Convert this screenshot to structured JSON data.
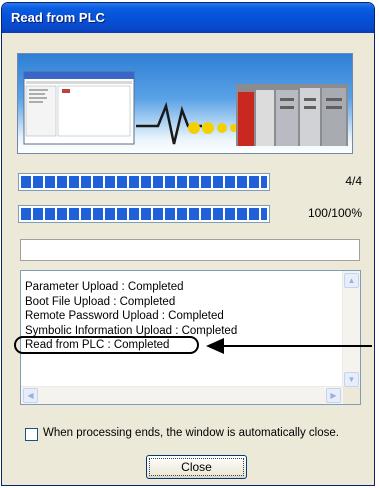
{
  "window": {
    "title": "Read from PLC"
  },
  "progress": {
    "step_count": "4/4",
    "step_fraction": 1.0,
    "percent_label": "100/100%",
    "percent_fraction": 1.0
  },
  "log": {
    "lines": [
      "Parameter Upload : Completed",
      "Boot File Upload : Completed",
      "Remote Password Upload : Completed",
      "Symbolic Information Upload : Completed",
      "Read from PLC : Completed"
    ]
  },
  "options": {
    "auto_close_label": "When processing ends, the window is automatically close.",
    "auto_close_checked": false
  },
  "buttons": {
    "close_label": "Close"
  },
  "colors": {
    "titlebar": "#0450d8",
    "progress_fill": "#2060d8",
    "dialog_bg": "#ece9d8"
  },
  "icons": {
    "banner": "pc-to-plc-transfer-illustration",
    "scroll_up": "triangle-up-icon",
    "scroll_down": "triangle-down-icon",
    "scroll_left": "triangle-left-icon",
    "scroll_right": "triangle-right-icon"
  }
}
